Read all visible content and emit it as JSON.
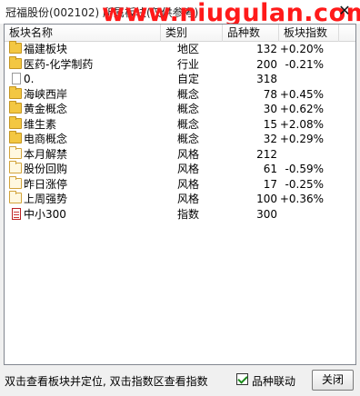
{
  "window": {
    "title": "冠福股份(002102)   所属板块(仅供参考)",
    "watermark": "www.niugulan.com"
  },
  "table": {
    "headers": [
      "板块名称",
      "类别",
      "品种数",
      "板块指数"
    ],
    "rows": [
      {
        "name": "福建板块",
        "type": "地区",
        "count": "132",
        "index": "+0.20%",
        "icon": "folder-icon"
      },
      {
        "name": "医药-化学制药",
        "type": "行业",
        "count": "200",
        "index": "-0.21%",
        "icon": "folder-icon"
      },
      {
        "name": "0.",
        "type": "自定",
        "count": "318",
        "index": "",
        "icon": "document-icon"
      },
      {
        "name": "海峡西岸",
        "type": "概念",
        "count": "78",
        "index": "+0.45%",
        "icon": "folder-icon"
      },
      {
        "name": "黄金概念",
        "type": "概念",
        "count": "30",
        "index": "+0.62%",
        "icon": "folder-icon"
      },
      {
        "name": "维生素",
        "type": "概念",
        "count": "15",
        "index": "+2.08%",
        "icon": "folder-icon"
      },
      {
        "name": "电商概念",
        "type": "概念",
        "count": "32",
        "index": "+0.29%",
        "icon": "folder-icon"
      },
      {
        "name": "本月解禁",
        "type": "风格",
        "count": "212",
        "index": "",
        "icon": "folder-outline-icon"
      },
      {
        "name": "股份回购",
        "type": "风格",
        "count": "61",
        "index": "-0.59%",
        "icon": "folder-outline-icon"
      },
      {
        "name": "昨日涨停",
        "type": "风格",
        "count": "17",
        "index": "-0.25%",
        "icon": "folder-outline-icon"
      },
      {
        "name": "上周强势",
        "type": "风格",
        "count": "100",
        "index": "+0.36%",
        "icon": "folder-outline-icon"
      },
      {
        "name": "中小300",
        "type": "指数",
        "count": "300",
        "index": "",
        "icon": "index-document-icon"
      }
    ]
  },
  "footer": {
    "hint": "双击查看板块并定位, 双击指数区查看指数",
    "linkage_label": "品种联动",
    "linkage_checked": true,
    "close_label": "关闭"
  }
}
